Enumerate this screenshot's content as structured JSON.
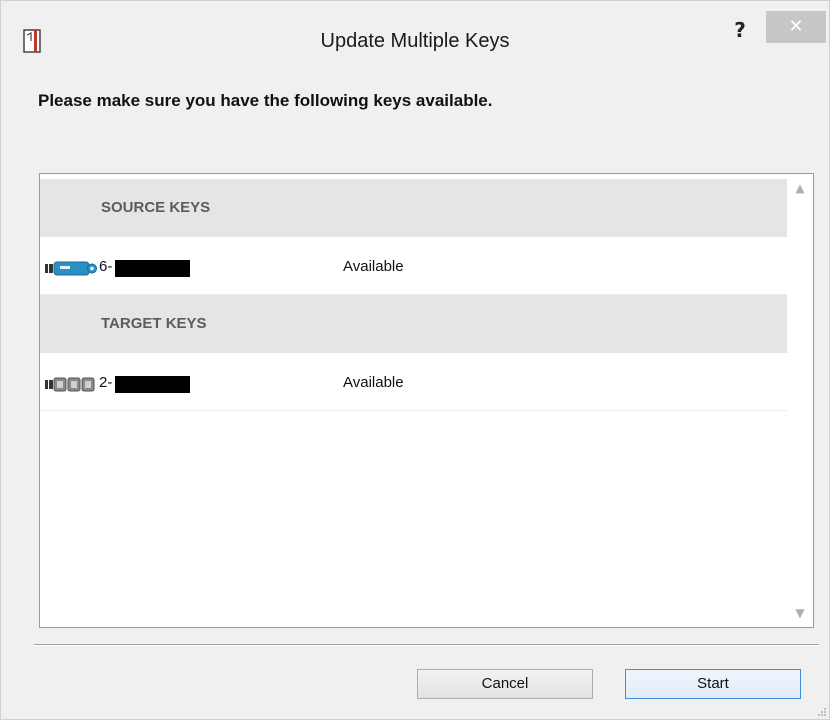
{
  "window": {
    "title": "Update Multiple Keys",
    "help_label": "?",
    "close_label": "✕"
  },
  "instruction": "Please make sure you have the following keys available.",
  "groups": [
    {
      "label": "SOURCE KEYS",
      "keys": [
        {
          "icon": "usb-key-blue-icon",
          "id_prefix": "6-",
          "id_redacted": true,
          "status": "Available"
        }
      ]
    },
    {
      "label": "TARGET KEYS",
      "keys": [
        {
          "icon": "usb-key-gray-icon",
          "id_prefix": "2-",
          "id_redacted": true,
          "status": "Available"
        }
      ]
    }
  ],
  "scrollbar": {
    "up_arrow": "▲",
    "down_arrow": "▼"
  },
  "buttons": {
    "cancel": "Cancel",
    "start": "Start"
  },
  "colors": {
    "source_key": "#2a8fc4",
    "target_key": "#8a8a8a",
    "close_button": "#c7c7c7",
    "group_header_bg": "#e5e5e5",
    "start_button_border": "#3c8fd8"
  }
}
